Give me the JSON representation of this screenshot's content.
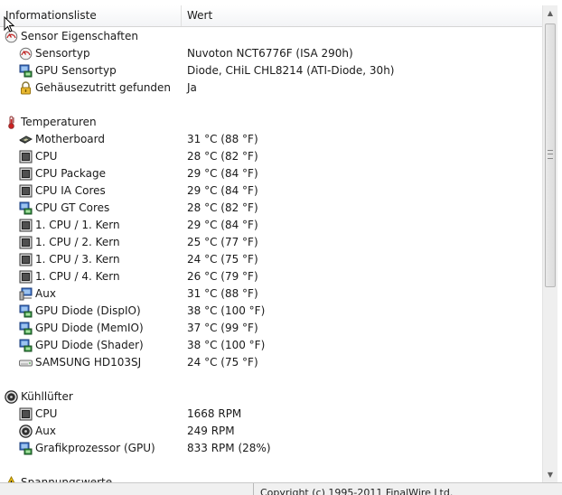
{
  "header": {
    "col1": "Informationsliste",
    "col2": "Wert"
  },
  "rows": [
    {
      "kind": "cat",
      "icon": "sensor-gauge-icon",
      "label": "Sensor Eigenschaften",
      "value": ""
    },
    {
      "kind": "item",
      "icon": "sensor-gauge-icon",
      "label": "Sensortyp",
      "value": "Nuvoton NCT6776F  (ISA 290h)"
    },
    {
      "kind": "item",
      "icon": "gpu-monitor-icon",
      "label": "GPU Sensortyp",
      "value": "Diode, CHiL CHL8214  (ATI-Diode, 30h)"
    },
    {
      "kind": "item",
      "icon": "lock-icon",
      "label": "Gehäusezutritt gefunden",
      "value": "Ja"
    },
    {
      "kind": "gap"
    },
    {
      "kind": "cat",
      "icon": "thermometer-icon",
      "label": "Temperaturen",
      "value": ""
    },
    {
      "kind": "item",
      "icon": "motherboard-icon",
      "label": "Motherboard",
      "value": "31 °C  (88 °F)"
    },
    {
      "kind": "item",
      "icon": "cpu-chip-icon",
      "label": "CPU",
      "value": "28 °C  (82 °F)"
    },
    {
      "kind": "item",
      "icon": "cpu-chip-icon",
      "label": "CPU Package",
      "value": "29 °C  (84 °F)"
    },
    {
      "kind": "item",
      "icon": "cpu-chip-icon",
      "label": "CPU IA Cores",
      "value": "29 °C  (84 °F)"
    },
    {
      "kind": "item",
      "icon": "gpu-monitor-icon",
      "label": "CPU GT Cores",
      "value": "28 °C  (82 °F)"
    },
    {
      "kind": "item",
      "icon": "cpu-chip-icon",
      "label": "1. CPU / 1. Kern",
      "value": "29 °C  (84 °F)"
    },
    {
      "kind": "item",
      "icon": "cpu-chip-icon",
      "label": "1. CPU / 2. Kern",
      "value": "25 °C  (77 °F)"
    },
    {
      "kind": "item",
      "icon": "cpu-chip-icon",
      "label": "1. CPU / 3. Kern",
      "value": "24 °C  (75 °F)"
    },
    {
      "kind": "item",
      "icon": "cpu-chip-icon",
      "label": "1. CPU / 4. Kern",
      "value": "26 °C  (79 °F)"
    },
    {
      "kind": "item",
      "icon": "aux-device-icon",
      "label": "Aux",
      "value": "31 °C  (88 °F)"
    },
    {
      "kind": "item",
      "icon": "gpu-monitor-icon",
      "label": "GPU Diode (DispIO)",
      "value": "38 °C  (100 °F)"
    },
    {
      "kind": "item",
      "icon": "gpu-monitor-icon",
      "label": "GPU Diode (MemIO)",
      "value": "37 °C  (99 °F)"
    },
    {
      "kind": "item",
      "icon": "gpu-monitor-icon",
      "label": "GPU Diode (Shader)",
      "value": "38 °C  (100 °F)"
    },
    {
      "kind": "item",
      "icon": "hard-drive-icon",
      "label": "SAMSUNG HD103SJ",
      "value": "24 °C  (75 °F)"
    },
    {
      "kind": "gap"
    },
    {
      "kind": "cat",
      "icon": "fan-icon",
      "label": "Kühllüfter",
      "value": ""
    },
    {
      "kind": "item",
      "icon": "cpu-chip-icon",
      "label": "CPU",
      "value": "1668 RPM"
    },
    {
      "kind": "item",
      "icon": "fan-icon",
      "label": "Aux",
      "value": "249 RPM"
    },
    {
      "kind": "item",
      "icon": "gpu-monitor-icon",
      "label": "Grafikprozessor (GPU)",
      "value": "833 RPM  (28%)"
    },
    {
      "kind": "gap"
    },
    {
      "kind": "cat",
      "icon": "warning-icon",
      "label": "Spannungswerte",
      "value": ""
    }
  ],
  "status": {
    "copyright": "Copyright (c) 1995-2011 FinalWire Ltd."
  }
}
